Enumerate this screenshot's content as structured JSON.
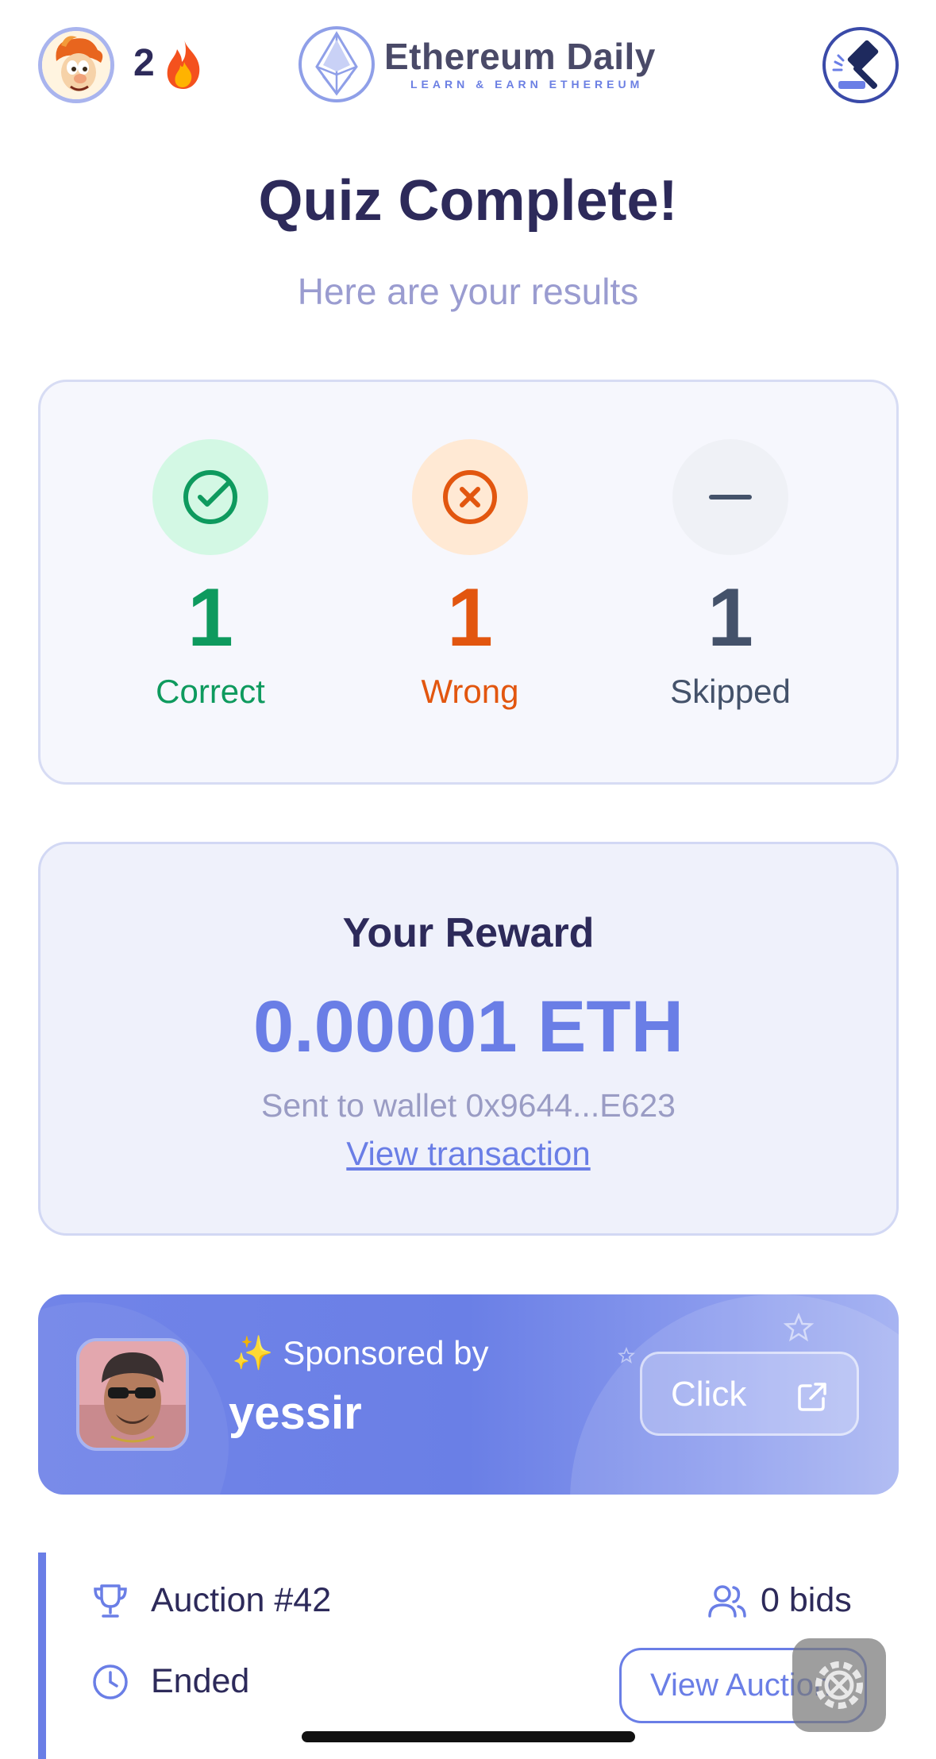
{
  "header": {
    "streak_count": "2",
    "logo_title": "Ethereum Daily",
    "logo_subtitle": "LEARN & EARN ETHEREUM",
    "icons": {
      "avatar": "user-avatar",
      "streak": "flame-icon",
      "logo": "ethereum-logo",
      "auction": "gavel-icon"
    }
  },
  "page": {
    "title": "Quiz Complete!",
    "subtitle": "Here are your results"
  },
  "results": {
    "correct": {
      "count": "1",
      "label": "Correct",
      "icon": "check-circle-icon",
      "color": "#0e9a5e"
    },
    "wrong": {
      "count": "1",
      "label": "Wrong",
      "icon": "x-circle-icon",
      "color": "#e2560f"
    },
    "skipped": {
      "count": "1",
      "label": "Skipped",
      "icon": "minus-icon",
      "color": "#44526a"
    }
  },
  "reward": {
    "title": "Your Reward",
    "amount": "0.00001 ETH",
    "wallet_text": "Sent to wallet 0x9644...E623",
    "link_label": "View transaction"
  },
  "sponsor": {
    "label": "Sponsored by",
    "name": "yessir",
    "button_label": "Click",
    "icons": {
      "sparkle": "sparkles-icon",
      "external": "external-link-icon"
    }
  },
  "auction": {
    "title": "Auction #42",
    "bids": "0 bids",
    "status": "Ended",
    "button_label": "View Auction",
    "icons": {
      "trophy": "trophy-icon",
      "users": "users-icon",
      "clock": "clock-icon"
    }
  },
  "colors": {
    "accent": "#6a7ee6",
    "title": "#2d2a5a",
    "muted": "#9a9cd0"
  }
}
